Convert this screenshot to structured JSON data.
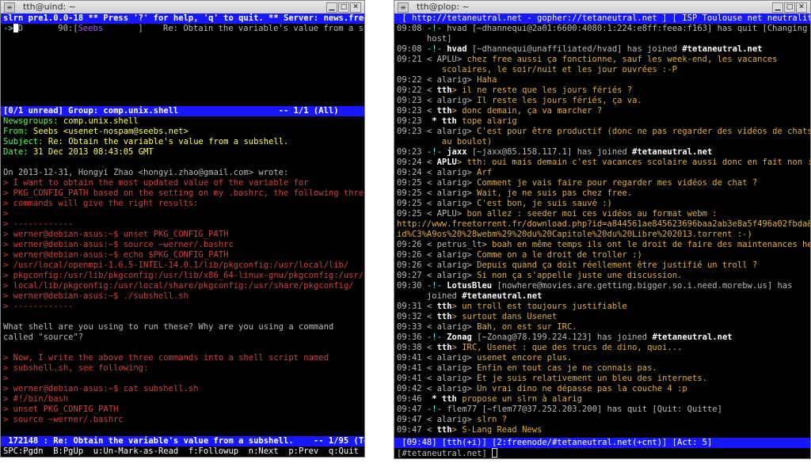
{
  "left": {
    "title": "tth@uind: ~",
    "header": "slrn pre1.0.0-18 ** Press '?' for help, 'q' to quit. ** Server: news.free.fr",
    "article_row": {
      "arrow": "->",
      "flag": "D",
      "score": "90",
      "author": "Seebs",
      "subject": "Re: Obtain the variable's value from a subshel"
    },
    "group_status": "[0/1 unread] Group: comp.unix.shell                    -- 1/1 (All)",
    "headers": {
      "newsgroups_label": "Newsgroups:",
      "newsgroups_value": "comp.unix.shell",
      "from_label": "From:",
      "from_value": "Seebs <usenet-nospam@seebs.net>",
      "subject_label": "Subject:",
      "subject_value": "Re: Obtain the variable's value from a subshell.",
      "date_label": "Date:",
      "date_value": "31 Dec 2013 08:43:05 GMT"
    },
    "body": [
      {
        "t": "",
        "c": "grey"
      },
      {
        "t": "On 2013-12-31, Hongyi Zhao <hongyi.zhao@gmail.com> wrote:",
        "c": "grey"
      },
      {
        "t": "> I want to obtain the most updated value of the variable for",
        "c": "red"
      },
      {
        "t": "> PKG_CONFIG_PATH based on the setting on my .bashrc, the following three",
        "c": "red"
      },
      {
        "t": "> commands will give the right results:",
        "c": "red"
      },
      {
        "t": ">",
        "c": "red"
      },
      {
        "t": "> ------------",
        "c": "red"
      },
      {
        "t": "> werner@debian-asus:~$ unset PKG_CONFIG_PATH",
        "c": "red"
      },
      {
        "t": "> werner@debian-asus:~$ source ~werner/.bashrc",
        "c": "red"
      },
      {
        "t": "> werner@debian-asus:~$ echo $PKG_CONFIG_PATH",
        "c": "red"
      },
      {
        "t": "> /usr/local/openmpi-1.6.5-INTEL-14.0.1/lib/pkgconfig:/usr/local/lib/",
        "c": "red"
      },
      {
        "t": "> pkgconfig:/usr/lib/pkgconfig:/usr/lib/x86_64-linux-gnu/pkgconfig:/usr/",
        "c": "red"
      },
      {
        "t": "> local/lib/pkgconfig:/usr/local/share/pkgconfig:/usr/share/pkgconfig/",
        "c": "red"
      },
      {
        "t": "> werner@debian-asus:~$ ./subshell.sh",
        "c": "red"
      },
      {
        "t": "> ------------",
        "c": "red"
      },
      {
        "t": "",
        "c": "grey"
      },
      {
        "t": "What shell are you using to run these? Why are you using a command",
        "c": "grey"
      },
      {
        "t": "called \"source\"?",
        "c": "grey"
      },
      {
        "t": "",
        "c": "grey"
      },
      {
        "t": "> Now, I write the above three commands into a shell script named",
        "c": "red"
      },
      {
        "t": "> subshell.sh, see following:",
        "c": "red"
      },
      {
        "t": ">",
        "c": "red"
      },
      {
        "t": "> werner@debian-asus:~$ cat subshell.sh",
        "c": "red"
      },
      {
        "t": "> #!/bin/bash",
        "c": "red"
      },
      {
        "t": "> unset PKG_CONFIG_PATH",
        "c": "red"
      },
      {
        "t": "> source ~werner/.bashrc",
        "c": "red"
      }
    ],
    "article_status": " 172148 : Re: Obtain the variable's value from a subshell.    -- 1/95 (Top)",
    "keyhelp": "SPC:Pgdn  B:PgUp  u:Un-Mark-as-Read  f:Followup  n:Next  p:Prev  q:Quit"
  },
  "right": {
    "title": "tth@plop: ~",
    "topic": " [ http://tetaneutral.net - gopher://tetaneutral.net ] [ ISP Toulouse net neutrality ]",
    "status": " [09:48] [tth(+i)] [2:freenode/#tetaneutral.net(+cnt)] [Act: 5]",
    "input": "[#tetaneutral.net] ",
    "messages": [
      [
        {
          "t": "09:08 ",
          "c": "grey"
        },
        {
          "t": "-!- ",
          "c": "cyan"
        },
        {
          "t": "hvad ",
          "c": "grey"
        },
        {
          "t": "[~dhannequi@2a01:6600:4080:1:224:e8ff:feea:f163] has quit [Changing",
          "c": "grey"
        }
      ],
      [
        {
          "t": "      host]",
          "c": "grey"
        }
      ],
      [
        {
          "t": "09:08 ",
          "c": "grey"
        },
        {
          "t": "-!- ",
          "c": "cyan"
        },
        {
          "t": "hvad ",
          "c": "white bold"
        },
        {
          "t": "[~dhannequi@unaffiliated/hvad] has joined ",
          "c": "grey"
        },
        {
          "t": "#tetaneutral.net",
          "c": "white bold"
        }
      ],
      [
        {
          "t": "09:21 ",
          "c": "grey"
        },
        {
          "t": "< APLU> ",
          "c": "grey"
        },
        {
          "t": "chez free aussi ça fonctionne, sauf les week-end, les vacances",
          "c": "orange"
        }
      ],
      [
        {
          "t": "         scolaires, le soir/nuit et les jour ouvrées :-P",
          "c": "orange"
        }
      ],
      [
        {
          "t": "09:22 ",
          "c": "grey"
        },
        {
          "t": "< alarig> ",
          "c": "grey"
        },
        {
          "t": "Haha",
          "c": "orange"
        }
      ],
      [
        {
          "t": "09:22 ",
          "c": "grey"
        },
        {
          "t": "< ",
          "c": "grey"
        },
        {
          "t": "tth",
          "c": "white bold"
        },
        {
          "t": "> il ne reste que les jours fériés ?",
          "c": "orange"
        }
      ],
      [
        {
          "t": "09:23 ",
          "c": "grey"
        },
        {
          "t": "< alarig> ",
          "c": "grey"
        },
        {
          "t": "Il reste les jours fériés, ça va.",
          "c": "orange"
        }
      ],
      [
        {
          "t": "09:23 ",
          "c": "grey"
        },
        {
          "t": "< ",
          "c": "grey"
        },
        {
          "t": "tth",
          "c": "white bold"
        },
        {
          "t": "> donc demain, ça va marcher ?",
          "c": "orange"
        }
      ],
      [
        {
          "t": "09:23 ",
          "c": "grey"
        },
        {
          "t": " * tth ",
          "c": "white bold"
        },
        {
          "t": "tope alarig",
          "c": "orange"
        }
      ],
      [
        {
          "t": "09:23 ",
          "c": "grey"
        },
        {
          "t": "< alarig> ",
          "c": "grey"
        },
        {
          "t": "C'est pour être productif (donc ne pas regarder des vidéos de chats",
          "c": "orange"
        }
      ],
      [
        {
          "t": "         au boulot)",
          "c": "orange"
        }
      ],
      [
        {
          "t": "09:23 ",
          "c": "grey"
        },
        {
          "t": "-!- ",
          "c": "cyan"
        },
        {
          "t": "jaxx ",
          "c": "white bold"
        },
        {
          "t": "[~jaxx@85.158.117.1] has joined ",
          "c": "grey"
        },
        {
          "t": "#tetaneutral.net",
          "c": "white bold"
        }
      ],
      [
        {
          "t": "09:24 ",
          "c": "grey"
        },
        {
          "t": "< ",
          "c": "grey"
        },
        {
          "t": "APLU",
          "c": "white bold"
        },
        {
          "t": "> tth: oui mais demain c'est vacances scolaire aussi donc en fait non :-D",
          "c": "orange"
        }
      ],
      [
        {
          "t": "09:24 ",
          "c": "grey"
        },
        {
          "t": "< alarig> ",
          "c": "grey"
        },
        {
          "t": "Arf",
          "c": "orange"
        }
      ],
      [
        {
          "t": "09:25 ",
          "c": "grey"
        },
        {
          "t": "< alarig> ",
          "c": "grey"
        },
        {
          "t": "Comment je vais faire pour regarder mes vidéos de chat ?",
          "c": "orange"
        }
      ],
      [
        {
          "t": "09:25 ",
          "c": "grey"
        },
        {
          "t": "< alarig> ",
          "c": "grey"
        },
        {
          "t": "Wait, je ne suis pas chez free.",
          "c": "orange"
        }
      ],
      [
        {
          "t": "09:25 ",
          "c": "grey"
        },
        {
          "t": "< alarig> ",
          "c": "grey"
        },
        {
          "t": "C'est bon, je suis sauvé :)",
          "c": "orange"
        }
      ],
      [
        {
          "t": "09:25 ",
          "c": "grey"
        },
        {
          "t": "< APLU> ",
          "c": "grey"
        },
        {
          "t": "bon allez : seeder moi ces vidéos au format webm :",
          "c": "orange"
        }
      ],
      [
        {
          "t": "http://www.freetorrent.fr/download.php?id=a844561ae845623696baa2ab3e8a5f496a02fbda&f=V",
          "c": "orange"
        }
      ],
      [
        {
          "t": "id%C3%A9os%20%28webm%29%20du%20Capitole%20du%20Libre%202013.torrent :-)",
          "c": "orange"
        }
      ],
      [
        {
          "t": "09:26 ",
          "c": "grey"
        },
        {
          "t": "< petrus_lt> ",
          "c": "grey"
        },
        {
          "t": "boah en même temps ils ont le droit de faire des maintenances hein",
          "c": "orange"
        }
      ],
      [
        {
          "t": "09:26 ",
          "c": "grey"
        },
        {
          "t": "< alarig> ",
          "c": "grey"
        },
        {
          "t": "Comme on a le droit de troller :)",
          "c": "orange"
        }
      ],
      [
        {
          "t": "09:26 ",
          "c": "grey"
        },
        {
          "t": "< alarig> ",
          "c": "grey"
        },
        {
          "t": "Depuis quand ça doit réellement être justifié un troll ?",
          "c": "orange"
        }
      ],
      [
        {
          "t": "09:27 ",
          "c": "grey"
        },
        {
          "t": "< alarig> ",
          "c": "grey"
        },
        {
          "t": "Si non ça s'appelle juste une discussion.",
          "c": "orange"
        }
      ],
      [
        {
          "t": "09:30 ",
          "c": "grey"
        },
        {
          "t": "-!- ",
          "c": "cyan"
        },
        {
          "t": "LotusBleu ",
          "c": "white bold"
        },
        {
          "t": "[nowhere@movies.are.getting.bigger.so.i.need.morebw.us] has",
          "c": "grey"
        }
      ],
      [
        {
          "t": "      joined ",
          "c": "grey"
        },
        {
          "t": "#tetaneutral.net",
          "c": "white bold"
        }
      ],
      [
        {
          "t": "09:31 ",
          "c": "grey"
        },
        {
          "t": "< ",
          "c": "grey"
        },
        {
          "t": "tth",
          "c": "white bold"
        },
        {
          "t": "> un troll est toujours justifiable",
          "c": "orange"
        }
      ],
      [
        {
          "t": "09:32 ",
          "c": "grey"
        },
        {
          "t": "< ",
          "c": "grey"
        },
        {
          "t": "tth",
          "c": "white bold"
        },
        {
          "t": "> surtout dans Usenet",
          "c": "orange"
        }
      ],
      [
        {
          "t": "09:33 ",
          "c": "grey"
        },
        {
          "t": "< alarig> ",
          "c": "grey"
        },
        {
          "t": "Bah, on est sur IRC.",
          "c": "orange"
        }
      ],
      [
        {
          "t": "09:36 ",
          "c": "grey"
        },
        {
          "t": "-!- ",
          "c": "cyan"
        },
        {
          "t": "Zonag ",
          "c": "white bold"
        },
        {
          "t": "[~Zonag@78.199.224.123] has joined ",
          "c": "grey"
        },
        {
          "t": "#tetaneutral.net",
          "c": "white bold"
        }
      ],
      [
        {
          "t": "09:38 ",
          "c": "grey"
        },
        {
          "t": "< ",
          "c": "grey"
        },
        {
          "t": "tth",
          "c": "white bold"
        },
        {
          "t": "> IRC, Usenet : que des trucs de dino, quoi...",
          "c": "orange"
        }
      ],
      [
        {
          "t": "09:41 ",
          "c": "grey"
        },
        {
          "t": "< alarig> ",
          "c": "grey"
        },
        {
          "t": "usenet encore plus.",
          "c": "orange"
        }
      ],
      [
        {
          "t": "09:41 ",
          "c": "grey"
        },
        {
          "t": "< alarig> ",
          "c": "grey"
        },
        {
          "t": "Enfin en tout cas je ne connais pas.",
          "c": "orange"
        }
      ],
      [
        {
          "t": "09:41 ",
          "c": "grey"
        },
        {
          "t": "< alarig> ",
          "c": "grey"
        },
        {
          "t": "Et je suis relativement un bleu des internets.",
          "c": "orange"
        }
      ],
      [
        {
          "t": "09:42 ",
          "c": "grey"
        },
        {
          "t": "< alarig> ",
          "c": "grey"
        },
        {
          "t": "Un vrai dino ne dépasse pas la couche 4 :p",
          "c": "orange"
        }
      ],
      [
        {
          "t": "09:46 ",
          "c": "grey"
        },
        {
          "t": " * tth ",
          "c": "white bold"
        },
        {
          "t": "propose un slrn à alarig",
          "c": "orange"
        }
      ],
      [
        {
          "t": "09:47 ",
          "c": "grey"
        },
        {
          "t": "-!- ",
          "c": "cyan"
        },
        {
          "t": "flem77 ",
          "c": "grey"
        },
        {
          "t": "[~flem77@37.252.203.200] has quit [Quit: Quitte]",
          "c": "grey"
        }
      ],
      [
        {
          "t": "09:47 ",
          "c": "grey"
        },
        {
          "t": "< alarig> ",
          "c": "grey"
        },
        {
          "t": "slrn ?",
          "c": "orange"
        }
      ],
      [
        {
          "t": "09:47 ",
          "c": "grey"
        },
        {
          "t": "< ",
          "c": "grey"
        },
        {
          "t": "tth",
          "c": "white bold"
        },
        {
          "t": "> S-Lang Read News",
          "c": "orange"
        }
      ]
    ]
  }
}
